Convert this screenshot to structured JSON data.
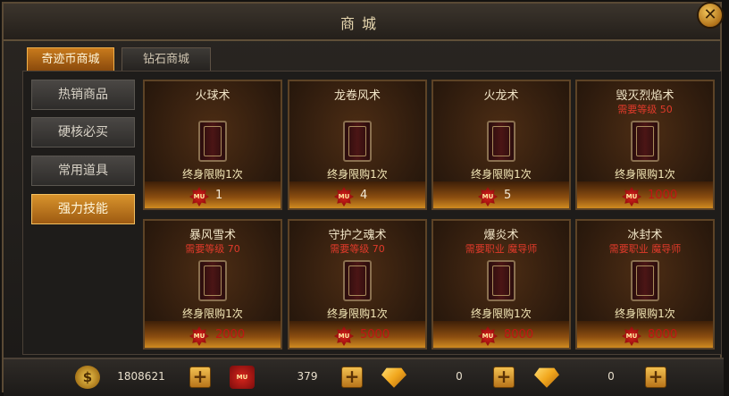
{
  "window": {
    "title": "商城",
    "close_label": "✕"
  },
  "tabs": [
    {
      "label": "奇迹币商城",
      "active": true
    },
    {
      "label": "钻石商城",
      "active": false
    }
  ],
  "sidebar": {
    "items": [
      {
        "label": "热销商品",
        "active": false
      },
      {
        "label": "硬核必买",
        "active": false
      },
      {
        "label": "常用道具",
        "active": false
      },
      {
        "label": "强力技能",
        "active": true
      }
    ]
  },
  "items": [
    {
      "name": "火球术",
      "requirement": "",
      "limit": "终身限购1次",
      "price": "1",
      "price_color": "#f3ead6"
    },
    {
      "name": "龙卷风术",
      "requirement": "",
      "limit": "终身限购1次",
      "price": "4",
      "price_color": "#f3ead6"
    },
    {
      "name": "火龙术",
      "requirement": "",
      "limit": "终身限购1次",
      "price": "5",
      "price_color": "#f3ead6"
    },
    {
      "name": "毁灭烈焰术",
      "requirement": "需要等级 50",
      "limit": "终身限购1次",
      "price": "1000",
      "price_color": "#c01414"
    },
    {
      "name": "暴风雪术",
      "requirement": "需要等级 70",
      "limit": "终身限购1次",
      "price": "2000",
      "price_color": "#c01414"
    },
    {
      "name": "守护之魂术",
      "requirement": "需要等级 70",
      "limit": "终身限购1次",
      "price": "5000",
      "price_color": "#c01414"
    },
    {
      "name": "爆炎术",
      "requirement": "需要职业 魔导师",
      "limit": "终身限购1次",
      "price": "8000",
      "price_color": "#c01414"
    },
    {
      "name": "冰封术",
      "requirement": "需要职业 魔导师",
      "limit": "终身限购1次",
      "price": "8000",
      "price_color": "#c01414"
    }
  ],
  "currencies": [
    {
      "icon": "gold-coin-icon",
      "glyph": "$",
      "value": "1808621",
      "plus": "+"
    },
    {
      "icon": "miracle-coin-icon",
      "glyph": "MU",
      "value": "379",
      "plus": "+"
    },
    {
      "icon": "diamond-icon",
      "glyph": "",
      "value": "0",
      "plus": "+"
    },
    {
      "icon": "bound-diamond-icon",
      "glyph": "",
      "value": "0",
      "plus": "+"
    }
  ],
  "price_icon_glyph": "MU"
}
